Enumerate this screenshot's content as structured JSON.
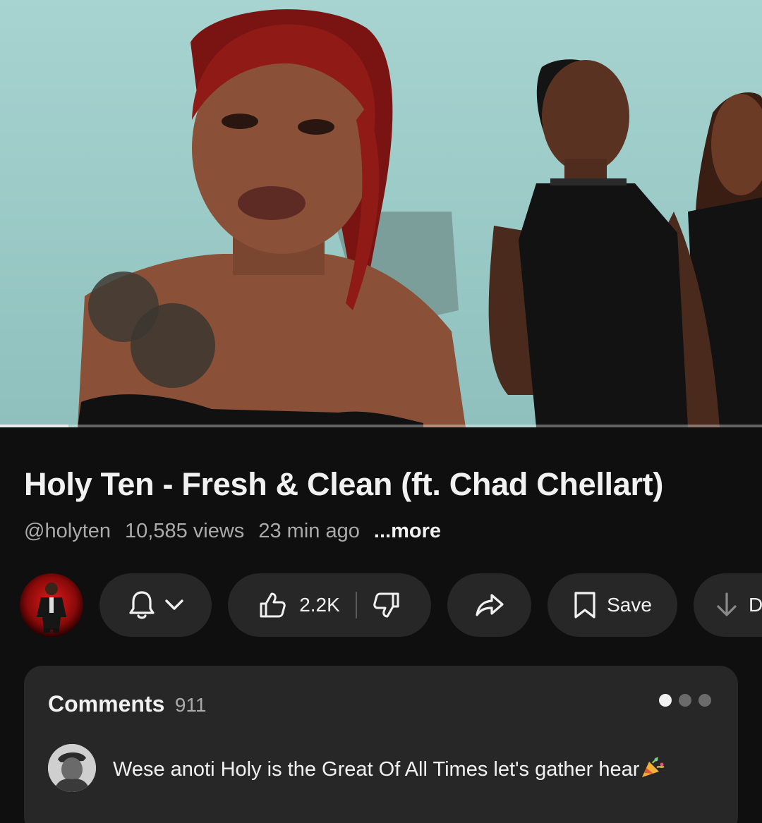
{
  "video": {
    "title": "Holy Ten - Fresh & Clean (ft. Chad Chellart)",
    "progress_fraction": 0.09
  },
  "meta": {
    "handle": "@holyten",
    "views": "10,585 views",
    "age": "23 min ago",
    "more": "...more"
  },
  "actions": {
    "like_count": "2.2K",
    "save_label": "Save",
    "download_label": "D"
  },
  "comments": {
    "label": "Comments",
    "count": "911",
    "top_comment": "Wese anoti Holy is the Great Of All Times let's gather hear"
  },
  "icons": {
    "subscribe": "bell-icon",
    "dropdown": "chevron-down-icon",
    "like": "thumbs-up-icon",
    "dislike": "thumbs-down-icon",
    "share": "share-arrow-icon",
    "save": "bookmark-icon",
    "download": "download-icon",
    "emoji": "party-popper-icon"
  },
  "colors": {
    "background": "#0f0f0f",
    "pill": "#272727",
    "text_primary": "#f1f1f1",
    "text_secondary": "#aaaaaa"
  }
}
